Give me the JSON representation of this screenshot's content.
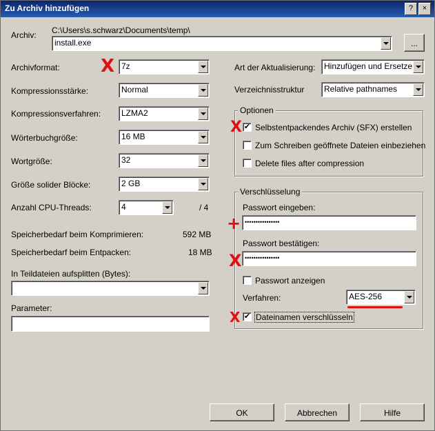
{
  "window": {
    "title": "Zu Archiv hinzufügen",
    "help_btn": "?",
    "close_btn": "×"
  },
  "archive": {
    "label": "Archiv:",
    "path": "C:\\Users\\s.schwarz\\Documents\\temp\\",
    "filename": "install.exe",
    "browse_label": "..."
  },
  "left": {
    "format_label": "Archivformat:",
    "format_value": "7z",
    "level_label": "Kompressionsstärke:",
    "level_value": "Normal",
    "method_label": "Kompressionsverfahren:",
    "method_value": "LZMA2",
    "dict_label": "Wörterbuchgröße:",
    "dict_value": "16 MB",
    "word_label": "Wortgröße:",
    "word_value": "32",
    "solid_label": "Größe solider Blöcke:",
    "solid_value": "2 GB",
    "threads_label": "Anzahl CPU-Threads:",
    "threads_value": "4",
    "threads_max": "/ 4",
    "mem_comp_label": "Speicherbedarf beim Komprimieren:",
    "mem_comp_value": "592 MB",
    "mem_decomp_label": "Speicherbedarf beim Entpacken:",
    "mem_decomp_value": "18 MB",
    "split_label": "In Teildateien aufsplitten (Bytes):",
    "split_value": "",
    "params_label": "Parameter:",
    "params_value": ""
  },
  "right": {
    "update_label": "Art der Aktualisierung:",
    "update_value": "Hinzufügen und Ersetzen",
    "paths_label": "Verzeichnisstruktur",
    "paths_value": "Relative pathnames",
    "options": {
      "title": "Optionen",
      "sfx_label": "Selbstentpackendes Archiv (SFX) erstellen",
      "sfx_checked": "✔",
      "shared_label": "Zum Schreiben geöffnete Dateien einbeziehen",
      "shared_checked": "",
      "delete_label": "Delete files after compression",
      "delete_checked": ""
    },
    "encryption": {
      "title": "Verschlüsselung",
      "pw_label": "Passwort eingeben:",
      "pw_value": "••••••••••••••••",
      "pw2_label": "Passwort bestätigen:",
      "pw2_value": "••••••••••••••••",
      "show_label": "Passwort anzeigen",
      "show_checked": "",
      "method_label": "Verfahren:",
      "method_value": "AES-256",
      "names_label": "Dateinamen verschlüsseln",
      "names_checked": "✔"
    }
  },
  "buttons": {
    "ok": "OK",
    "cancel": "Abbrechen",
    "help": "Hilfe"
  },
  "annotations": {
    "x": "X",
    "plus": "+"
  }
}
